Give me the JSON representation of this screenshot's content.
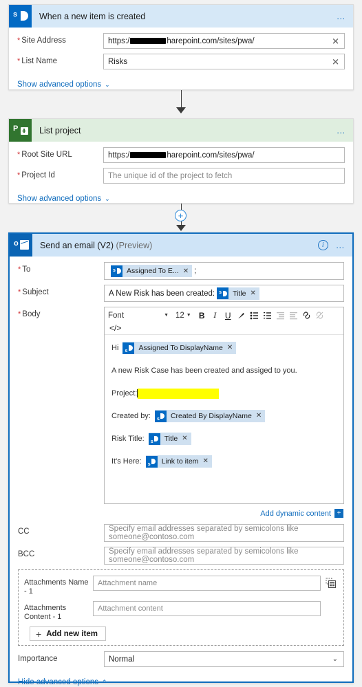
{
  "flow": {
    "trigger_card": {
      "icon": "sharepoint-icon",
      "title": "When a new item is created",
      "more_label": "…",
      "fields": [
        {
          "label": "Site Address",
          "required": true,
          "value_prefix": "https:/",
          "value_suffix": "harepoint.com/sites/pwa/",
          "redacted": true,
          "has_clear": true
        },
        {
          "label": "List Name",
          "required": true,
          "value": "Risks",
          "has_clear": true
        }
      ],
      "advanced_link": "Show advanced options"
    },
    "project_card": {
      "icon": "project-icon",
      "title": "List project",
      "more_label": "…",
      "fields": [
        {
          "label": "Root Site URL",
          "required": true,
          "value_prefix": "https:/",
          "value_suffix": "harepoint.com/sites/pwa/",
          "redacted": true
        },
        {
          "label": "Project Id",
          "required": true,
          "placeholder": "The unique id of the project to fetch"
        }
      ],
      "advanced_link": "Show advanced options"
    },
    "email_card": {
      "icon": "outlook-icon",
      "title": "Send an email (V2)",
      "title_suffix": "(Preview)",
      "info_label": "i",
      "more_label": "…",
      "to": {
        "label": "To",
        "required": true,
        "chips": [
          {
            "text": "Assigned To E...",
            "icon": "sharepoint-token-icon"
          }
        ],
        "trailing_text": ";"
      },
      "subject": {
        "label": "Subject",
        "required": true,
        "text": "A New Risk has been created:",
        "chips": [
          {
            "text": "Title",
            "icon": "sharepoint-token-icon"
          }
        ]
      },
      "body": {
        "label": "Body",
        "required": true,
        "toolbar": {
          "font_label": "Font",
          "size_label": "12",
          "bold": "B",
          "italic": "I",
          "underline": "U",
          "highlight": "highlighter-icon",
          "bullet_list": "bulleted-list-icon",
          "number_list": "numbered-list-icon",
          "indent": "indent-icon",
          "outdent": "outdent-icon",
          "link": "link-icon",
          "unlink": "unlink-icon",
          "code_view": "</>"
        },
        "lines": [
          {
            "prefix": "Hi",
            "chip": "Assigned To DisplayName"
          },
          {
            "prefix": "A new Risk Case has been created and assiged to you."
          },
          {
            "prefix": "Project:",
            "highlight": true
          },
          {
            "prefix": "Created by:",
            "chip": "Created By DisplayName"
          },
          {
            "prefix": "Risk Title:",
            "chip": "Title"
          },
          {
            "prefix": "It's Here:",
            "chip": "Link to item"
          }
        ]
      },
      "add_dynamic_content": "Add dynamic content",
      "add_dynamic_plus": "+",
      "cc": {
        "label": "CC",
        "placeholder": "Specify email addresses separated by semicolons like someone@contoso.com"
      },
      "bcc": {
        "label": "BCC",
        "placeholder": "Specify email addresses separated by semicolons like someone@contoso.com"
      },
      "attachments": {
        "name_label": "Attachments Name - 1",
        "name_placeholder": "Attachment name",
        "content_label": "Attachments Content - 1",
        "content_placeholder": "Attachment content",
        "add_new_item": "Add new item",
        "picker_icon": "dynamic-content-picker-icon"
      },
      "importance": {
        "label": "Importance",
        "value": "Normal"
      },
      "advanced_link": "Hide advanced options"
    },
    "connector_plus": "+"
  },
  "colors": {
    "sharepoint_blue": "#036ac4",
    "project_green": "#31752f",
    "outlook_blue": "#0a64b4",
    "link_blue": "#0f6cbd",
    "required_red": "#d13438",
    "highlight_yellow": "#ffff00"
  }
}
